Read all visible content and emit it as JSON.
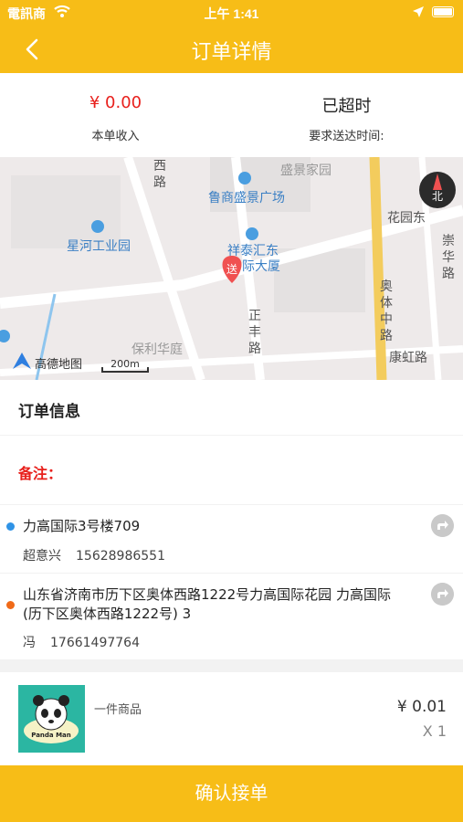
{
  "status_bar": {
    "carrier": "電訊商",
    "time": "上午 1:41"
  },
  "nav": {
    "title": "订单详情",
    "back_icon": "chevron-left-icon"
  },
  "summary": {
    "income_value": "¥ 0.00",
    "income_label": "本单收入",
    "delivery_value": "已超时",
    "delivery_label": "要求送达时间:"
  },
  "map": {
    "labels": {
      "xi_lu": "西\n路",
      "shengjing": "盛景家园",
      "lushang": "鲁商盛景广场",
      "huayuan": "花园东",
      "chonghua": "崇\n华\n路",
      "xinghe": "星河工业园",
      "xiangtai": "祥泰汇东",
      "guoji": "际大厦",
      "marker": "送",
      "aoti": "奥\n体\n中\n路",
      "zhengfeng": "正\n丰\n路",
      "poly": "保利华庭",
      "kanghong": "康虹路",
      "logo": "高德地图",
      "scale": "200m",
      "compass": "北"
    }
  },
  "order_info": {
    "title": "订单信息",
    "remark_label": "备注："
  },
  "pickup": {
    "address": "力高国际3号楼709",
    "contact_name": "超意兴",
    "contact_phone": "15628986551",
    "dot_color": "#2f93e6"
  },
  "dropoff": {
    "address": "山东省济南市历下区奥体西路1222号力高国际花园 力高国际(历下区奥体西路1222号) 3",
    "contact_name": "冯",
    "contact_phone": "17661497764",
    "dot_color": "#f06a18"
  },
  "goods": {
    "image_text": "Panda Man",
    "name": "一件商品",
    "price": "¥ 0.01",
    "quantity": "X 1"
  },
  "actions": {
    "confirm_label": "确认接单"
  },
  "colors": {
    "brand": "#f7bd17",
    "alert": "#e8201c"
  }
}
